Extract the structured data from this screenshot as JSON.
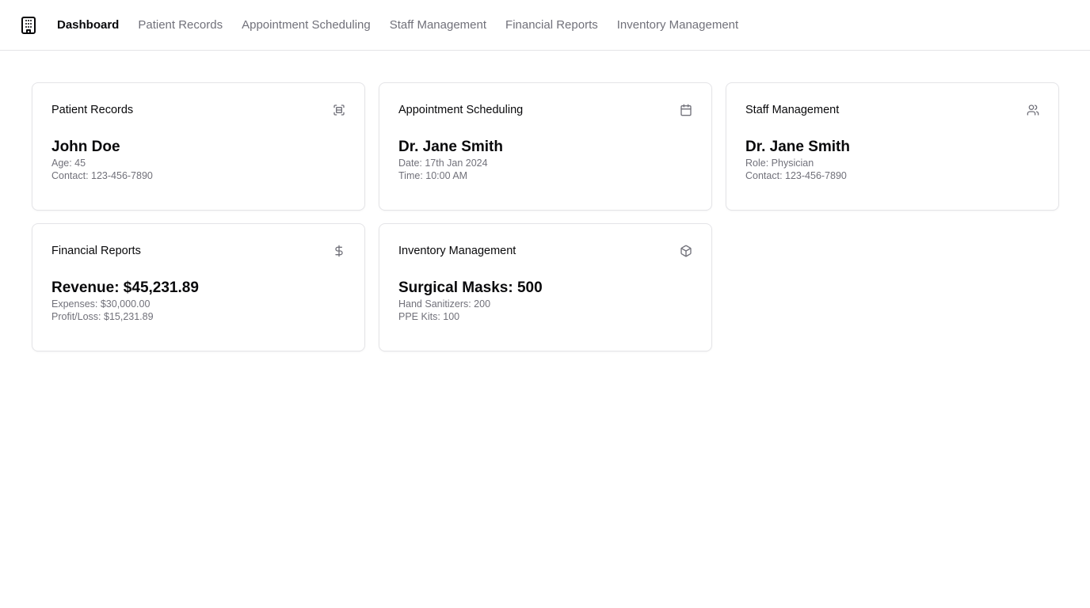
{
  "nav": {
    "logo_icon": "hospital-building-icon",
    "items": [
      {
        "label": "Dashboard",
        "active": true
      },
      {
        "label": "Patient Records",
        "active": false
      },
      {
        "label": "Appointment Scheduling",
        "active": false
      },
      {
        "label": "Staff Management",
        "active": false
      },
      {
        "label": "Financial Reports",
        "active": false
      },
      {
        "label": "Inventory Management",
        "active": false
      }
    ]
  },
  "cards": [
    {
      "title": "Patient Records",
      "icon": "scan-face-icon",
      "main": "John Doe",
      "line1": "Age: 45",
      "line2": "Contact: 123-456-7890"
    },
    {
      "title": "Appointment Scheduling",
      "icon": "calendar-icon",
      "main": "Dr. Jane Smith",
      "line1": "Date: 17th Jan 2024",
      "line2": "Time: 10:00 AM"
    },
    {
      "title": "Staff Management",
      "icon": "users-icon",
      "main": "Dr. Jane Smith",
      "line1": "Role: Physician",
      "line2": "Contact: 123-456-7890"
    },
    {
      "title": "Financial Reports",
      "icon": "dollar-sign-icon",
      "main": "Revenue: $45,231.89",
      "line1": "Expenses: $30,000.00",
      "line2": "Profit/Loss: $15,231.89"
    },
    {
      "title": "Inventory Management",
      "icon": "box-icon",
      "main": "Surgical Masks: 500",
      "line1": "Hand Sanitizers: 200",
      "line2": "PPE Kits: 100"
    }
  ],
  "colors": {
    "text_primary": "#09090b",
    "text_muted": "#71717a",
    "border": "#e4e4e7"
  }
}
